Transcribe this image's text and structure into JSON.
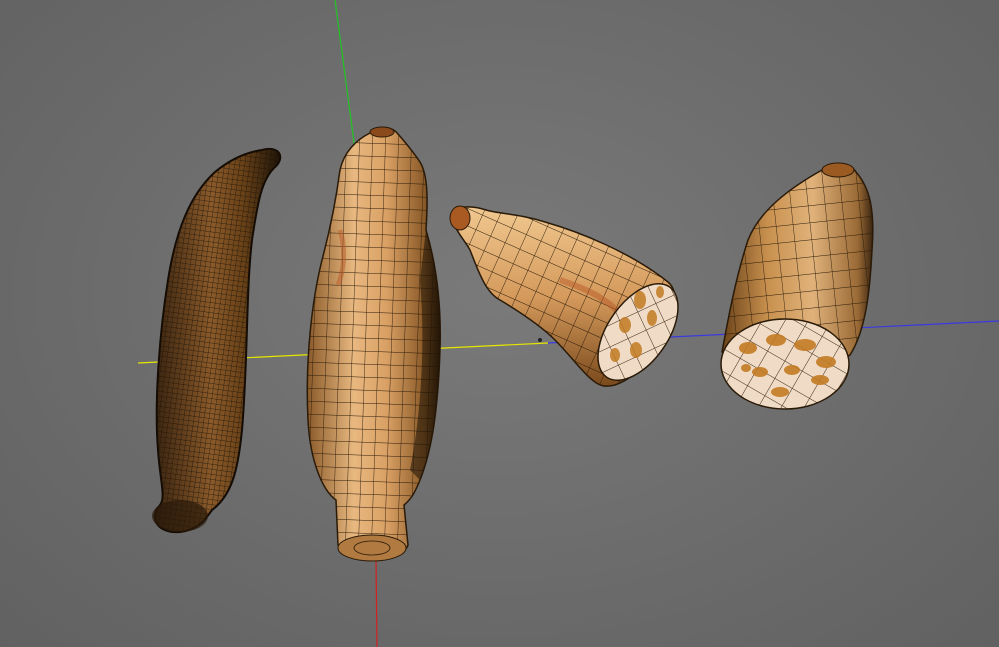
{
  "viewport": {
    "background_color": "#6e6e6e",
    "axes": {
      "x_axis_color": "#e6e600",
      "y_axis_color": "#22c422",
      "z_axis_color": "#3a3ae0",
      "down_axis_color": "#d42020"
    },
    "models": [
      {
        "name": "lotus-root-whole-dark",
        "mesh": "dense-wireframe",
        "color": "#7a4a1e"
      },
      {
        "name": "lotus-root-whole-standing",
        "mesh": "wireframe",
        "color": "#d9a06a"
      },
      {
        "name": "lotus-root-cut-tilted",
        "mesh": "wireframe",
        "color": "#d49a62"
      },
      {
        "name": "lotus-root-cut-cross-section",
        "mesh": "wireframe",
        "color": "#c99258"
      }
    ],
    "cross_section_color": "#f0dcc6",
    "hole_color": "#c27a22"
  }
}
